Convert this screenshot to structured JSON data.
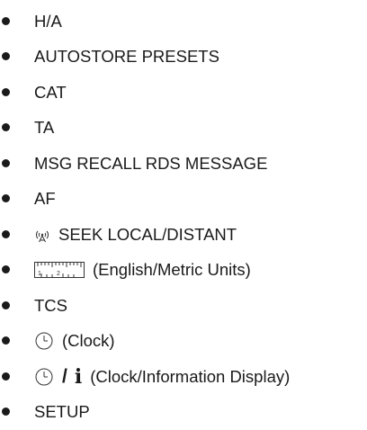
{
  "items": [
    {
      "text": "H/A"
    },
    {
      "text": "AUTOSTORE PRESETS"
    },
    {
      "text": "CAT"
    },
    {
      "text": "TA"
    },
    {
      "text": "MSG RECALL RDS MESSAGE"
    },
    {
      "text": "AF"
    },
    {
      "text": "SEEK LOCAL/DISTANT",
      "icon": "antenna-signal-icon"
    },
    {
      "text": "(English/Metric Units)",
      "icon": "ruler-icon",
      "ruler_ticks": [
        "1",
        "2"
      ]
    },
    {
      "text": "TCS"
    },
    {
      "text": "(Clock)",
      "icon": "clock-icon"
    },
    {
      "text": "(Clock/Information Display)",
      "icon": "clock-icon",
      "extra_icon": "info-icon",
      "separator": "/",
      "info_glyph": "i"
    },
    {
      "text": "SETUP"
    }
  ]
}
